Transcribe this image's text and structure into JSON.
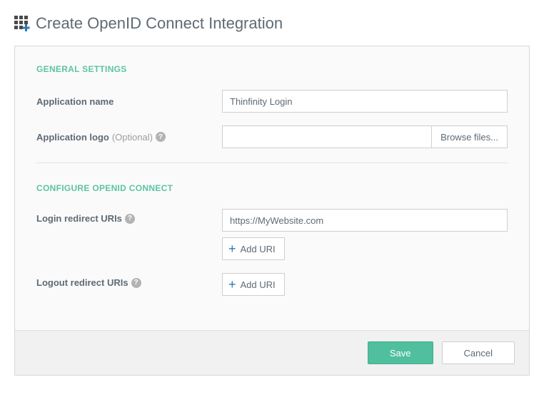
{
  "page": {
    "title": "Create OpenID Connect Integration"
  },
  "sections": {
    "general": {
      "title": "GENERAL SETTINGS",
      "app_name_label": "Application name",
      "app_name_value": "Thinfinity Login",
      "app_logo_label": "Application logo",
      "app_logo_optional": "(Optional)",
      "browse_label": "Browse files..."
    },
    "oidc": {
      "title": "CONFIGURE OPENID CONNECT",
      "login_label": "Login redirect URIs",
      "login_value": "https://MyWebsite.com",
      "logout_label": "Logout redirect URIs",
      "add_uri_label": "Add URI"
    }
  },
  "footer": {
    "save": "Save",
    "cancel": "Cancel"
  },
  "help": {
    "mark": "?"
  }
}
